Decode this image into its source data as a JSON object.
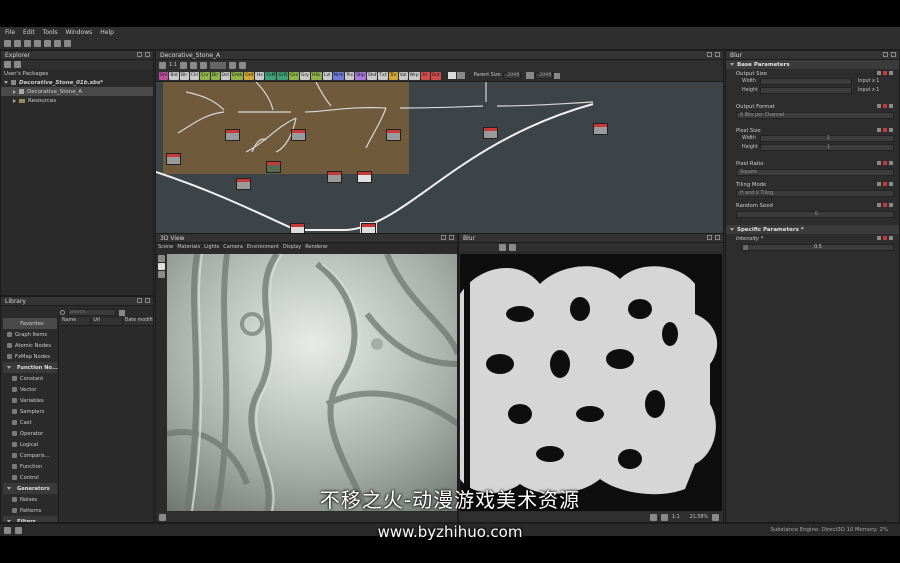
{
  "menu": [
    "File",
    "Edit",
    "Tools",
    "Windows",
    "Help"
  ],
  "explorer": {
    "title": "Explorer",
    "section": "User's Packages",
    "package": "Decorative_Stone_01b.sbs*",
    "graph": "Decorative_Stone_A",
    "resources": "Resources"
  },
  "library": {
    "title": "Library",
    "search_placeholder": "Search",
    "columns": [
      "Name",
      "Url",
      "Date modifi"
    ],
    "items": [
      {
        "label": "Favorites",
        "kind": "plain"
      },
      {
        "label": "Graph Items",
        "kind": "item"
      },
      {
        "label": "Atomic Nodes",
        "kind": "item"
      },
      {
        "label": "FxMap Nodes",
        "kind": "item"
      },
      {
        "label": "Function No...",
        "kind": "head"
      },
      {
        "label": "Constant",
        "kind": "sub"
      },
      {
        "label": "Vector",
        "kind": "sub"
      },
      {
        "label": "Variables",
        "kind": "sub"
      },
      {
        "label": "Samplers",
        "kind": "sub"
      },
      {
        "label": "Cast",
        "kind": "sub"
      },
      {
        "label": "Operator",
        "kind": "sub"
      },
      {
        "label": "Logical",
        "kind": "sub"
      },
      {
        "label": "Comparis...",
        "kind": "sub"
      },
      {
        "label": "Function",
        "kind": "sub"
      },
      {
        "label": "Control",
        "kind": "sub"
      },
      {
        "label": "Generators",
        "kind": "head"
      },
      {
        "label": "Noises",
        "kind": "sub"
      },
      {
        "label": "Patterns",
        "kind": "sub"
      },
      {
        "label": "Filters",
        "kind": "head"
      }
    ]
  },
  "graph_tab": {
    "title": "Decorative_Stone_A",
    "zoom": "1:1",
    "parent_size_label": "Parent Size:",
    "parent_size": "2048",
    "size2": "2048",
    "chips": [
      {
        "t": "Uni",
        "c": "#b94f9c"
      },
      {
        "t": "Bld",
        "c": "#c9c9c9"
      },
      {
        "t": "Blr",
        "c": "#c9c9c9"
      },
      {
        "t": "Chl",
        "c": "#c9c9c9"
      },
      {
        "t": "Crv",
        "c": "#8fb34a"
      },
      {
        "t": "Dir",
        "c": "#8fb34a"
      },
      {
        "t": "Dst",
        "c": "#c9c9c9"
      },
      {
        "t": "Emb",
        "c": "#8fb34a"
      },
      {
        "t": "Grd",
        "c": "#d1a63a"
      },
      {
        "t": "Hs",
        "c": "#c9c9c9"
      },
      {
        "t": "FxM",
        "c": "#3fa07a"
      },
      {
        "t": "GrD",
        "c": "#3fa07a"
      },
      {
        "t": "Grs",
        "c": "#8fb34a"
      },
      {
        "t": "Gry",
        "c": "#c9c9c9"
      },
      {
        "t": "HSL",
        "c": "#8fb34a"
      },
      {
        "t": "Lvl",
        "c": "#c9c9c9"
      },
      {
        "t": "Nrm",
        "c": "#6f7bd6"
      },
      {
        "t": "Pix",
        "c": "#c9c9c9"
      },
      {
        "t": "Shp",
        "c": "#a57bd6"
      },
      {
        "t": "Shd",
        "c": "#c9c9c9"
      },
      {
        "t": "Txt",
        "c": "#c9c9c9"
      },
      {
        "t": "Trs",
        "c": "#d1a63a"
      },
      {
        "t": "Val",
        "c": "#c9c9c9"
      },
      {
        "t": "Wrp",
        "c": "#c9c9c9"
      },
      {
        "t": "In",
        "c": "#cf4d4d"
      },
      {
        "t": "Out",
        "c": "#cf4d4d"
      }
    ]
  },
  "view3d": {
    "title": "3D View",
    "menu": [
      "Scene",
      "Materials",
      "Lights",
      "Camera",
      "Environment",
      "Display",
      "Renderer"
    ]
  },
  "view2d": {
    "title": "Blur",
    "zoom_ratio": "1:1",
    "zoom_pct": "21.58%"
  },
  "props": {
    "title": "Blur",
    "base_section": "Base Parameters",
    "output_size": "Output Size",
    "width": "Width",
    "height": "Height",
    "width_val": "Input x 1",
    "height_val": "Input x 1",
    "output_format": "Output Format",
    "output_format_val": "8 Bits per Channel",
    "pixel_size": "Pixel Size",
    "pixel_w": "1",
    "pixel_h": "1",
    "pixel_ratio": "Pixel Ratio",
    "pixel_ratio_val": "Square",
    "tiling_mode": "Tiling Mode",
    "tiling_val": "H and V Tiling",
    "random_seed": "Random Seed",
    "random_seed_val": "0",
    "specific_section": "Specific Parameters *",
    "intensity": "Intensity *",
    "intensity_val": "0.5",
    "intensity_fraction": 0.03
  },
  "status": "Substance Engine: Direct3D 10  Memory: 2%",
  "watermark": {
    "cn": "不移之火-动漫游戏美术资源",
    "url": "www.byzhihuo.com"
  },
  "colors": {
    "accent": "#c83a3a",
    "frame_bg": "#705a3c",
    "graph_bg": "#3c4448",
    "highlight": "#5a5a5a"
  }
}
